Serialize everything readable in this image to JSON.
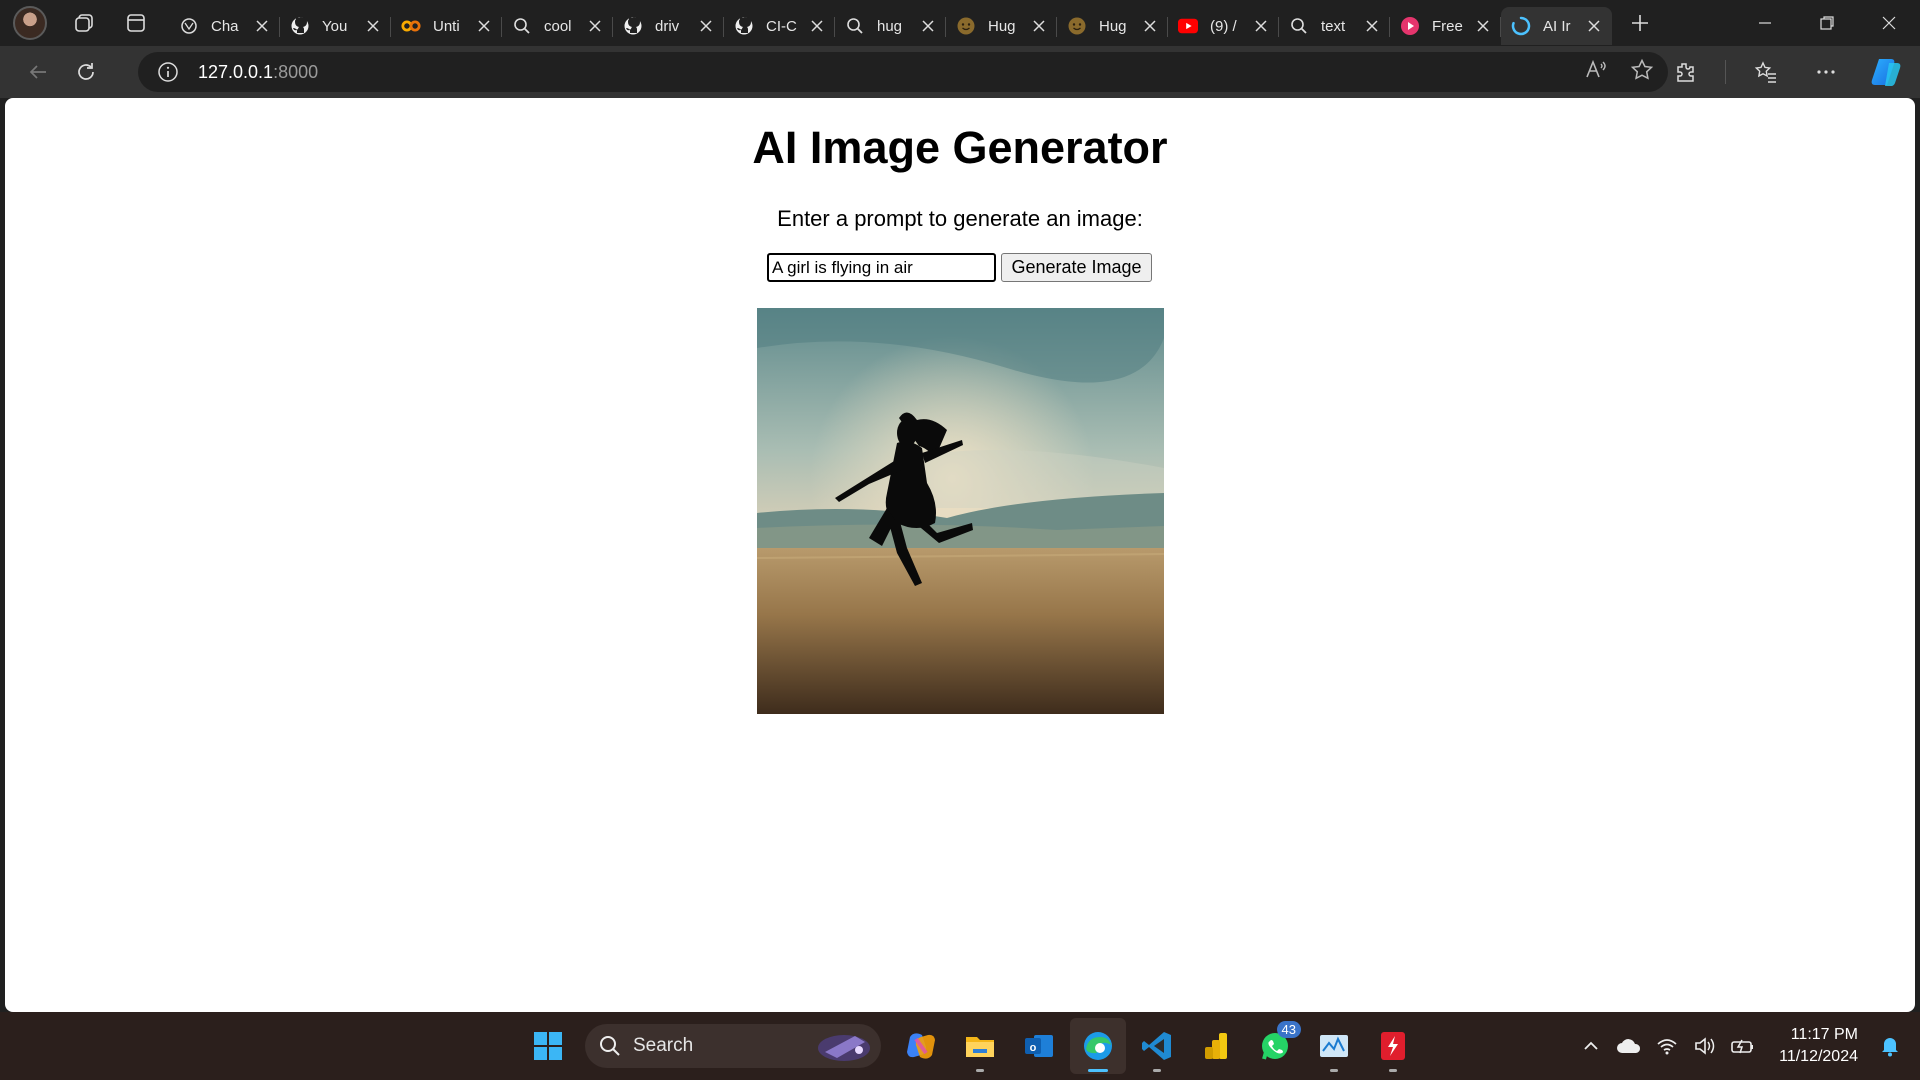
{
  "browser": {
    "tabs": [
      {
        "title": "Cha",
        "icon": "openai-icon"
      },
      {
        "title": "You",
        "icon": "github-icon"
      },
      {
        "title": "Unti",
        "icon": "colab-icon"
      },
      {
        "title": "cool",
        "icon": "search-icon"
      },
      {
        "title": "driv",
        "icon": "github-icon"
      },
      {
        "title": "CI-C",
        "icon": "github-icon"
      },
      {
        "title": "hug",
        "icon": "search-icon"
      },
      {
        "title": "Hug",
        "icon": "huggingface-icon"
      },
      {
        "title": "Hug",
        "icon": "huggingface-icon"
      },
      {
        "title": "(9) /",
        "icon": "youtube-icon"
      },
      {
        "title": "text",
        "icon": "search-icon"
      },
      {
        "title": "Free",
        "icon": "app-icon"
      },
      {
        "title": "AI Ir",
        "icon": "loading-icon",
        "active": true
      }
    ],
    "url": {
      "host": "127.0.0.1",
      "port": ":8000"
    }
  },
  "page": {
    "heading": "AI Image Generator",
    "instruction": "Enter a prompt to generate an image:",
    "prompt_value": "A girl is flying in air",
    "button_label": "Generate Image",
    "image_alt": "Generated image"
  },
  "taskbar": {
    "search_label": "Search",
    "whatsapp_badge": "43",
    "time": "11:17 PM",
    "date": "11/12/2024"
  },
  "colors": {
    "accent": "#4cc2ff",
    "window_bg": "#202020",
    "toolbar_bg": "#333333",
    "taskbar_bg": "#2b1f1c"
  }
}
